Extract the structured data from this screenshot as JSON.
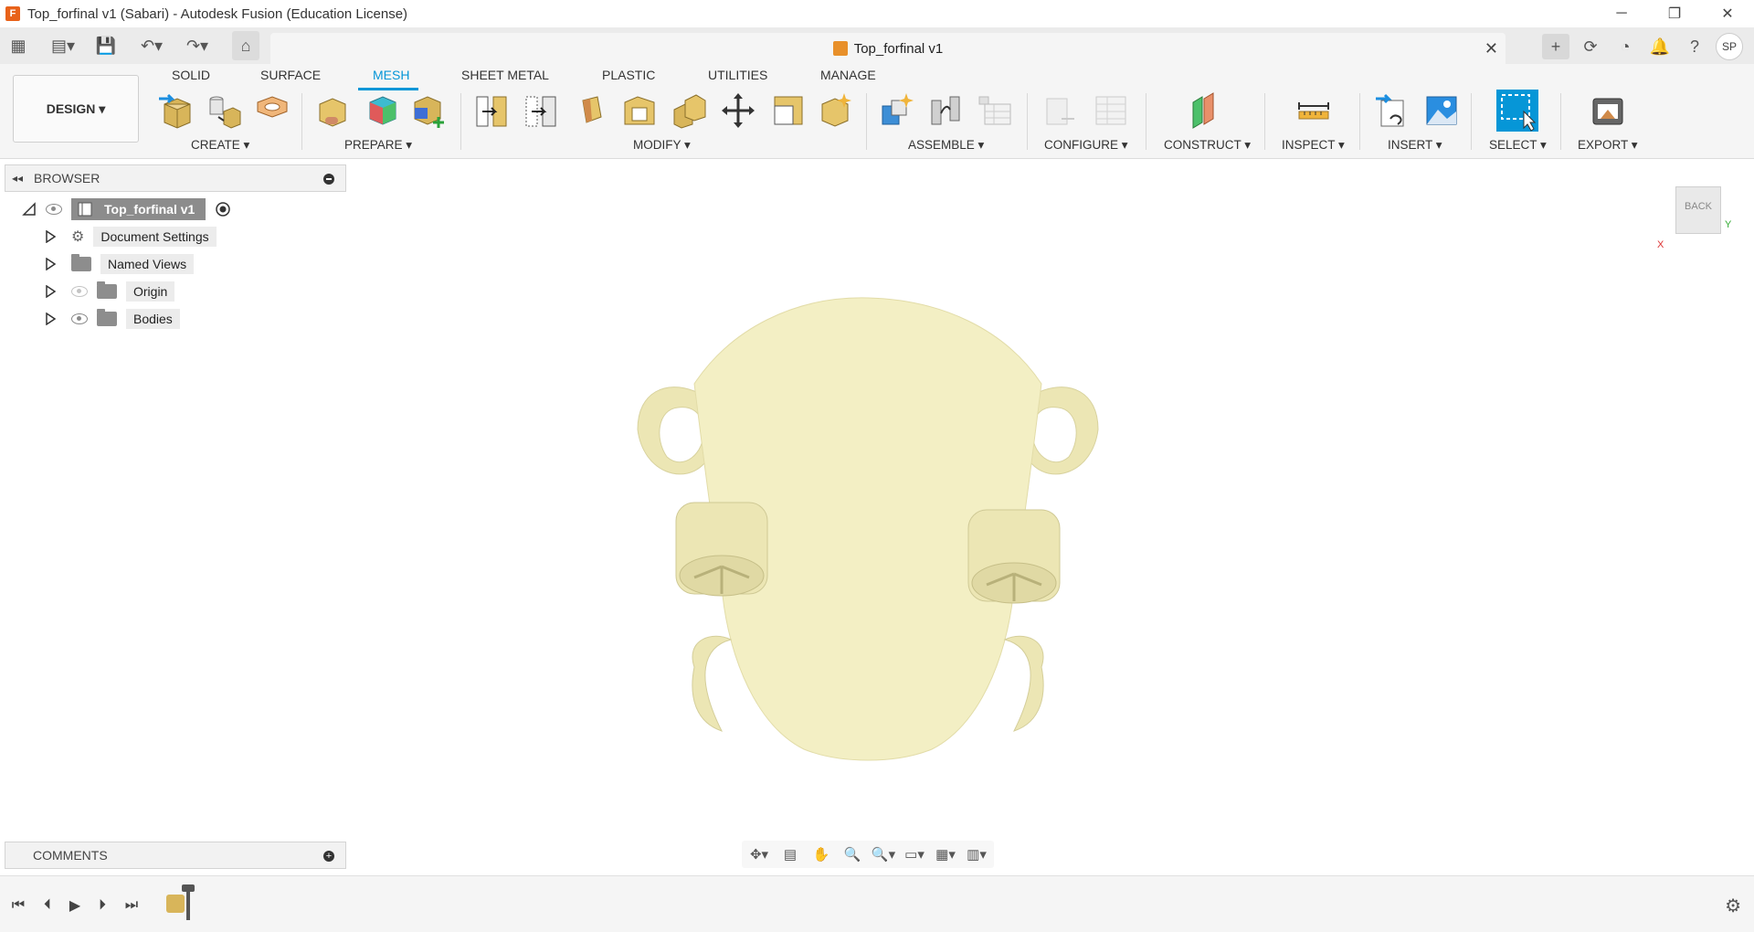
{
  "window": {
    "title": "Top_forfinal v1 (Sabari) - Autodesk Fusion (Education License)",
    "app_logo_letter": "F",
    "minimize_label": "─",
    "restore_label": "❐",
    "close_label": "✕"
  },
  "quick_access": {
    "grid_icon": "▦",
    "file_icon": "▤▾",
    "save_icon": "💾",
    "undo_icon": "↶▾",
    "redo_icon": "↷▾",
    "home_icon": "⌂"
  },
  "document_tab": {
    "name": "Top_forfinal v1",
    "close": "✕"
  },
  "top_right": {
    "add_icon": "+",
    "online_icon": "⟳",
    "job_icon": "◔",
    "notification_icon": "🔔",
    "help_icon": "?",
    "user_initials": "SP"
  },
  "ribbon": {
    "workspace": "DESIGN ▾",
    "tabs": [
      "SOLID",
      "SURFACE",
      "MESH",
      "SHEET METAL",
      "PLASTIC",
      "UTILITIES",
      "MANAGE"
    ],
    "active_tab": "MESH",
    "groups": [
      "CREATE ▾",
      "PREPARE ▾",
      "MODIFY ▾",
      "ASSEMBLE ▾",
      "CONFIGURE ▾",
      "CONSTRUCT ▾",
      "INSPECT ▾",
      "INSERT ▾",
      "SELECT ▾",
      "EXPORT ▾"
    ]
  },
  "browser": {
    "collapse_icon": "◂◂",
    "title": "BROWSER",
    "root": "Top_forfinal v1",
    "items": [
      {
        "label": "Document Settings",
        "icon": "gear-icon"
      },
      {
        "label": "Named Views",
        "icon": "folder-icon"
      },
      {
        "label": "Origin",
        "icon": "folder-icon",
        "visibility": "hidden"
      },
      {
        "label": "Bodies",
        "icon": "folder-icon",
        "visibility": "visible"
      }
    ]
  },
  "comments": {
    "title": "COMMENTS",
    "add": "+"
  },
  "view_cube": {
    "face": "BACK",
    "x_axis": "X",
    "y_axis": "Y"
  },
  "nav_bar": [
    "✥▾",
    "▤",
    "✋",
    "🔍",
    "🔍▾",
    "▭▾",
    "▦▾",
    "▥▾"
  ],
  "timeline": {
    "first": "⏮",
    "prev": "⏴",
    "play": "▶",
    "next": "⏵",
    "last": "⏭",
    "settings": "⚙"
  },
  "colors": {
    "accent": "#0696d7",
    "model_fill": "#f3efc4",
    "model_shade": "#d9d4a3"
  }
}
